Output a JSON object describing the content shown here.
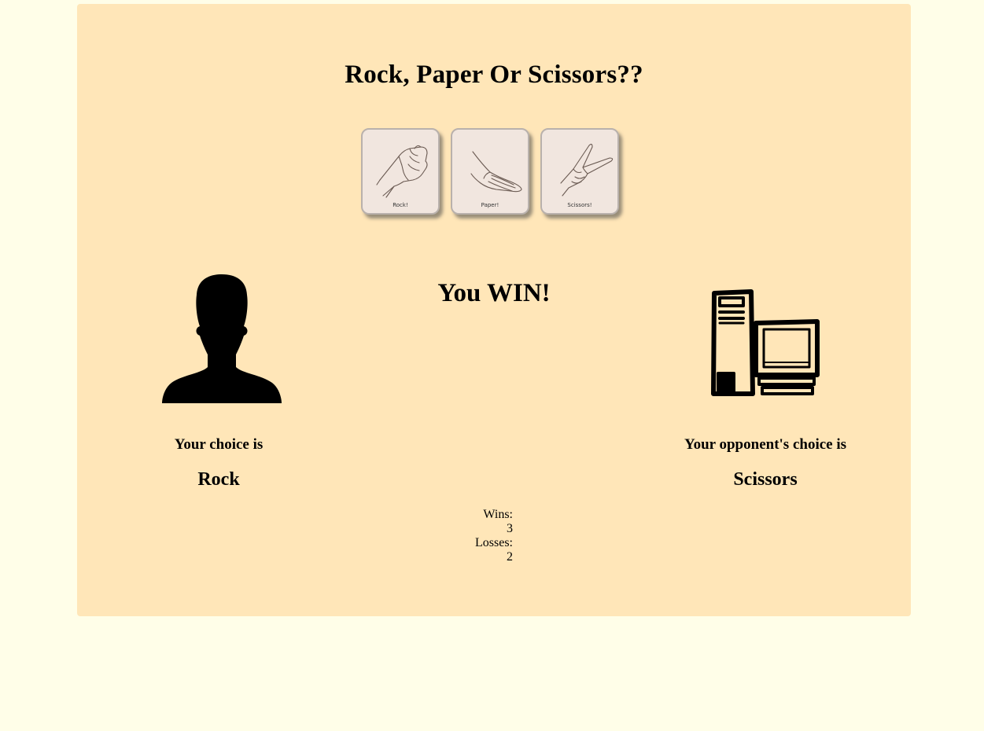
{
  "page": {
    "title": "Rock, Paper Or Scissors??",
    "background_color": "#fffee8",
    "panel_color": "#ffe6b8"
  },
  "choices": [
    {
      "name": "rock",
      "label": "Rock!",
      "icon": "fist-hand-icon"
    },
    {
      "name": "paper",
      "label": "Paper!",
      "icon": "flat-hand-icon"
    },
    {
      "name": "scissors",
      "label": "Scissors!",
      "icon": "v-sign-hand-icon"
    }
  ],
  "result": "You WIN!",
  "player": {
    "icon": "person-silhouette-icon",
    "caption": "Your choice is",
    "choice": "Rock"
  },
  "opponent": {
    "icon": "computer-icon",
    "caption": "Your opponent's choice is",
    "choice": "Scissors"
  },
  "score": {
    "wins_label": "Wins:",
    "wins": "3",
    "losses_label": "Losses:",
    "losses": "2"
  }
}
